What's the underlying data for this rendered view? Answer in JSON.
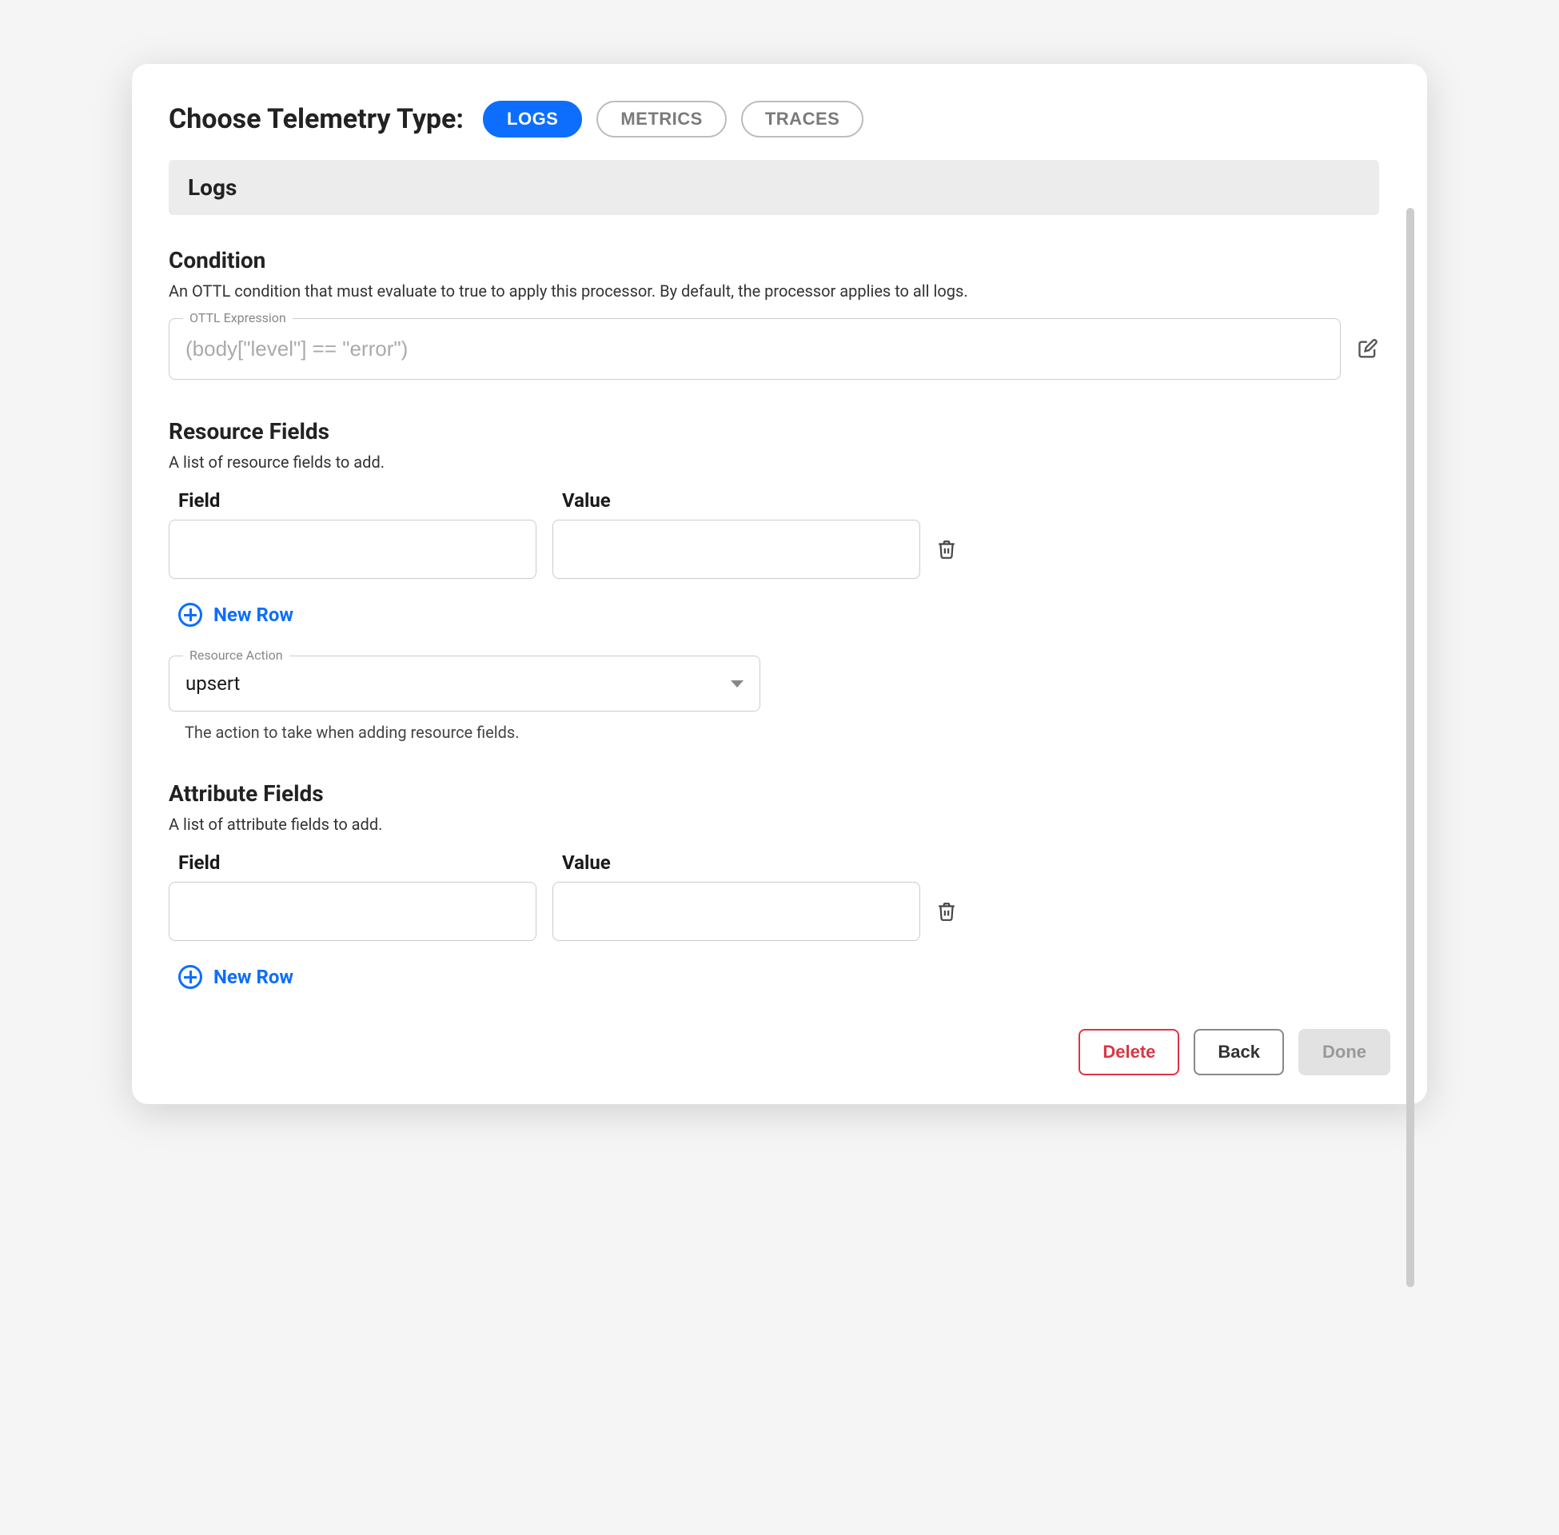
{
  "header": {
    "title": "Choose Telemetry Type:",
    "tabs": [
      {
        "label": "LOGS",
        "active": true
      },
      {
        "label": "METRICS",
        "active": false
      },
      {
        "label": "TRACES",
        "active": false
      }
    ]
  },
  "sectionBar": "Logs",
  "condition": {
    "title": "Condition",
    "description": "An OTTL condition that must evaluate to true to apply this processor. By default, the processor applies to all logs.",
    "fieldLabel": "OTTL Expression",
    "placeholder": "(body[\"level\"] == \"error\")",
    "value": ""
  },
  "resourceFields": {
    "title": "Resource Fields",
    "description": "A list of resource fields to add.",
    "headers": {
      "field": "Field",
      "value": "Value"
    },
    "rows": [
      {
        "field": "",
        "value": ""
      }
    ],
    "newRowLabel": "New Row",
    "action": {
      "label": "Resource Action",
      "value": "upsert",
      "help": "The action to take when adding resource fields."
    }
  },
  "attributeFields": {
    "title": "Attribute Fields",
    "description": "A list of attribute fields to add.",
    "headers": {
      "field": "Field",
      "value": "Value"
    },
    "rows": [
      {
        "field": "",
        "value": ""
      }
    ],
    "newRowLabel": "New Row"
  },
  "footer": {
    "delete": "Delete",
    "back": "Back",
    "done": "Done"
  }
}
